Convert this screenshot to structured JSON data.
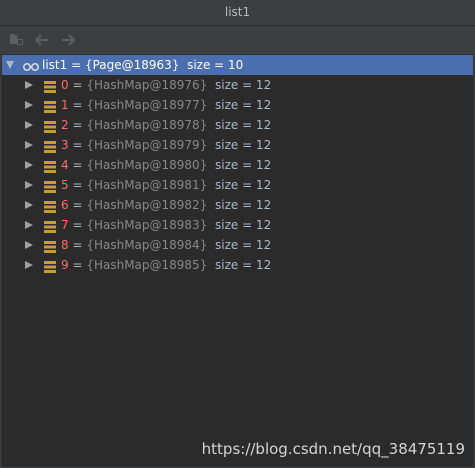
{
  "window": {
    "title": "list1"
  },
  "toolbar": {
    "buttons": [
      {
        "icon": "watch-folder-icon"
      },
      {
        "icon": "back-arrow-icon"
      },
      {
        "icon": "forward-arrow-icon"
      }
    ]
  },
  "tree": {
    "root": {
      "name": "list1",
      "eq": " = ",
      "value": "{Page@18963}",
      "size": "size = 10",
      "icon": "glasses-watch-icon",
      "expanded": true
    },
    "children": [
      {
        "index": "0",
        "eq": " = ",
        "value": "{HashMap@18976}",
        "size": "size = 12"
      },
      {
        "index": "1",
        "eq": " = ",
        "value": "{HashMap@18977}",
        "size": "size = 12"
      },
      {
        "index": "2",
        "eq": " = ",
        "value": "{HashMap@18978}",
        "size": "size = 12"
      },
      {
        "index": "3",
        "eq": " = ",
        "value": "{HashMap@18979}",
        "size": "size = 12"
      },
      {
        "index": "4",
        "eq": " = ",
        "value": "{HashMap@18980}",
        "size": "size = 12"
      },
      {
        "index": "5",
        "eq": " = ",
        "value": "{HashMap@18981}",
        "size": "size = 12"
      },
      {
        "index": "6",
        "eq": " = ",
        "value": "{HashMap@18982}",
        "size": "size = 12"
      },
      {
        "index": "7",
        "eq": " = ",
        "value": "{HashMap@18983}",
        "size": "size = 12"
      },
      {
        "index": "8",
        "eq": " = ",
        "value": "{HashMap@18984}",
        "size": "size = 12"
      },
      {
        "index": "9",
        "eq": " = ",
        "value": "{HashMap@18985}",
        "size": "size = 12"
      }
    ]
  },
  "watermark": "https://blog.csdn.net/qq_38475119",
  "colors": {
    "selection": "#4b6eaf",
    "index_red": "#ff6b68",
    "map_icon": "#c89a3e"
  }
}
